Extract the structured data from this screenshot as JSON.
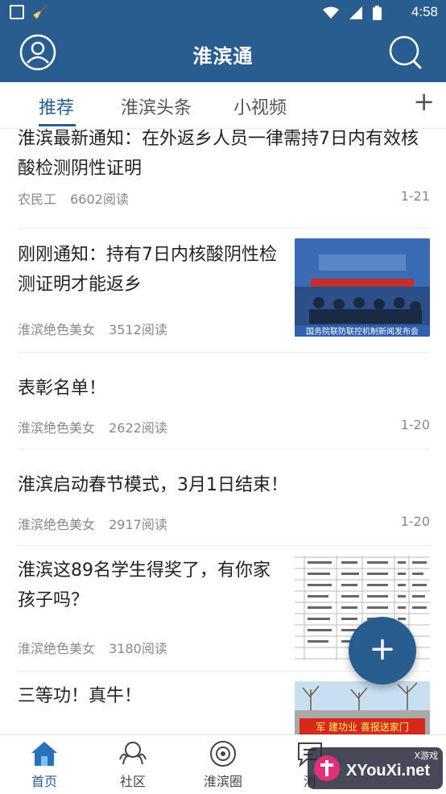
{
  "status_bar": {
    "time": "4:58"
  },
  "app_bar": {
    "title": "淮滨通",
    "avatar_icon": "user-icon",
    "search_icon": "search-icon"
  },
  "tabs": [
    {
      "label": "推荐",
      "active": true
    },
    {
      "label": "淮滨头条",
      "active": false
    },
    {
      "label": "小视频",
      "active": false
    }
  ],
  "tab_add_label": "+",
  "feed": [
    {
      "title": "淮滨最新通知：在外返乡人员一律需持7日内有效核酸检测阴性证明",
      "author": "农民工",
      "reads": "6602阅读",
      "date": "1-21",
      "has_thumb": false
    },
    {
      "title": "刚刚通知：持有7日内核酸阴性检测证明才能返乡",
      "author": "淮滨绝色美女",
      "reads": "3512阅读",
      "date": "",
      "has_thumb": true
    },
    {
      "title": "表彰名单！",
      "author": "淮滨绝色美女",
      "reads": "2622阅读",
      "date": "1-20",
      "has_thumb": false
    },
    {
      "title": "淮滨启动春节模式，3月1日结束！",
      "author": "淮滨绝色美女",
      "reads": "2917阅读",
      "date": "1-20",
      "has_thumb": false
    },
    {
      "title": "淮滨这89名学生得奖了，有你家孩子吗？",
      "author": "淮滨绝色美女",
      "reads": "3180阅读",
      "date": "",
      "has_thumb": true
    },
    {
      "title": "三等功！真牛！",
      "author": "",
      "reads": "",
      "date": "",
      "has_thumb": true
    }
  ],
  "thumb_captions": {
    "news_conf_banner": "国务院联防联控机制新闻发布会",
    "award_banner": "军 建功业  喜报送家门"
  },
  "fab_label": "+",
  "bottom_nav": [
    {
      "label": "首页",
      "icon": "home-icon",
      "active": true
    },
    {
      "label": "社区",
      "icon": "community-icon",
      "active": false
    },
    {
      "label": "淮滨圈",
      "icon": "circle-icon",
      "active": false
    },
    {
      "label": "消",
      "icon": "message-icon",
      "active": false
    }
  ],
  "watermark": {
    "top": "X游戏",
    "text": "XYouXi.net"
  },
  "colors": {
    "primary": "#2a5d8f",
    "text": "#222222",
    "meta": "#888888"
  }
}
